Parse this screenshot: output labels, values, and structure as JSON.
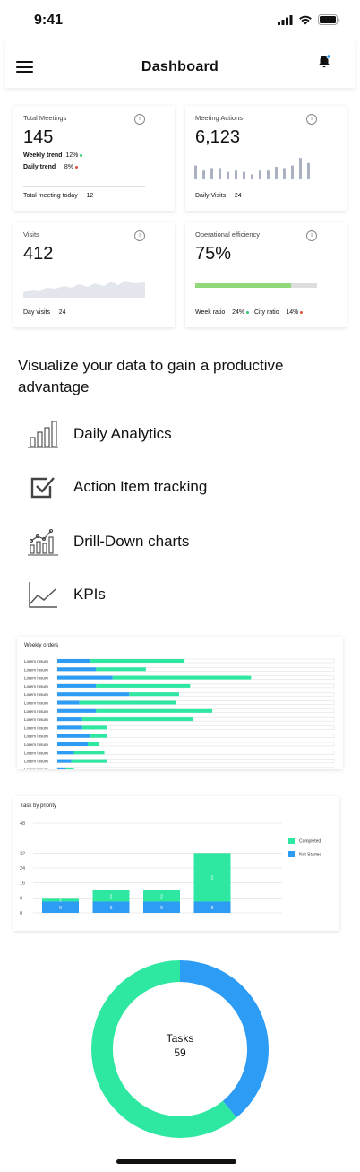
{
  "status": {
    "time": "9:41"
  },
  "header": {
    "title": "Dashboard"
  },
  "cards": {
    "meetings": {
      "label": "Total Meetings",
      "value": "145",
      "weekly_label": "Weekly trend",
      "weekly_value": "12%",
      "daily_label": "Daily trend",
      "daily_value": "8%",
      "footer_label": "Total meeting today",
      "footer_value": "12"
    },
    "actions": {
      "label": "Meeting Actions",
      "value": "6,123",
      "footer_label": "Daily Visits",
      "footer_value": "24",
      "bars": [
        0.55,
        0.35,
        0.45,
        0.45,
        0.3,
        0.35,
        0.3,
        0.2,
        0.35,
        0.35,
        0.5,
        0.45,
        0.55,
        0.85,
        0.65
      ]
    },
    "visits": {
      "label": "Visits",
      "value": "412",
      "footer_label": "Day visits",
      "footer_value": "24"
    },
    "efficiency": {
      "label": "Operational efficiency",
      "value": "75%",
      "progress": 0.79,
      "week_label": "Week ratio",
      "week_value": "24%",
      "city_label": "City ratio",
      "city_value": "14%"
    }
  },
  "promo": {
    "heading": "Visualize your data to gain a productive advantage",
    "features": [
      {
        "label": "Daily Analytics",
        "icon": "bar-chart-icon"
      },
      {
        "label": "Action Item tracking",
        "icon": "checkbox-icon"
      },
      {
        "label": "Drill-Down charts",
        "icon": "drill-down-chart-icon"
      },
      {
        "label": "KPIs",
        "icon": "line-chart-icon"
      }
    ]
  },
  "colors": {
    "green": "#2ee8a2",
    "blue": "#2d9cf5",
    "progress_green": "#8fd97a",
    "up": "#2ecc71",
    "down": "#e74c3c"
  },
  "chart_data": [
    {
      "type": "bar",
      "title": "Weekly orders",
      "orientation": "horizontal",
      "categories": [
        "Lorem Ipsum",
        "Lorem Ipsum",
        "Lorem Ipsum",
        "Lorem Ipsum",
        "Lorem Ipsum",
        "Lorem Ipsum",
        "Lorem Ipsum",
        "Lorem Ipsum",
        "Lorem Ipsum",
        "Lorem Ipsum",
        "Lorem Ipsum",
        "Lorem Ipsum",
        "Lorem Ipsum",
        "Lorem Ipsum"
      ],
      "series": [
        {
          "color": "#2d9cf5",
          "values": [
            12,
            14,
            20,
            14,
            26,
            8,
            14,
            9,
            9,
            12,
            11,
            6,
            5,
            3
          ]
        },
        {
          "color": "#2ee8a2",
          "values": [
            34,
            18,
            50,
            34,
            18,
            35,
            42,
            40,
            9,
            6,
            4,
            11,
            13,
            3
          ]
        }
      ],
      "xlim": [
        0,
        100
      ]
    },
    {
      "type": "bar",
      "stacked": true,
      "title": "Task by priority",
      "categories": [
        "",
        "",
        "",
        ""
      ],
      "yticks": [
        48,
        32,
        24,
        16,
        8,
        0
      ],
      "ylim": [
        0,
        48
      ],
      "series": [
        {
          "name": "Not Started",
          "color": "#2d9cf5",
          "values": [
            6,
            6,
            6,
            6
          ],
          "labels": [
            "6",
            "6",
            "6",
            "6"
          ]
        },
        {
          "name": "Completed",
          "color": "#2ee8a2",
          "values": [
            2,
            6,
            6,
            26
          ],
          "labels": [
            "2",
            "2",
            "2",
            "2"
          ]
        }
      ],
      "legend": "right"
    },
    {
      "type": "pie",
      "donut": true,
      "center_label": "Tasks",
      "center_value": "59",
      "values": [
        {
          "color": "#2ee8a2",
          "value": 36
        },
        {
          "color": "#2d9cf5",
          "value": 23
        }
      ]
    }
  ]
}
